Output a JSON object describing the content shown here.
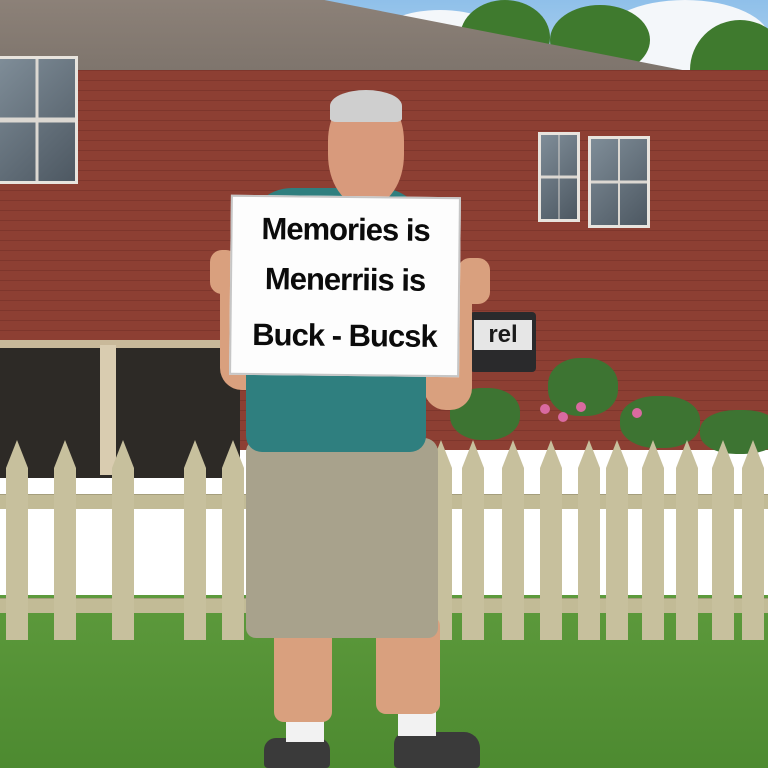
{
  "photo": {
    "description_alt": "photo-scene"
  },
  "sign": {
    "line1": "Memories is",
    "line2": "Menerriis is",
    "line3": "Buck - Bucsk"
  },
  "store_sign": {
    "text": "rel"
  },
  "colors": {
    "brick": "#8d3f33",
    "shirt": "#2f7f7f",
    "shorts": "#a8a28c",
    "grass": "#5d9a3c",
    "fence": "#c7c09d"
  }
}
